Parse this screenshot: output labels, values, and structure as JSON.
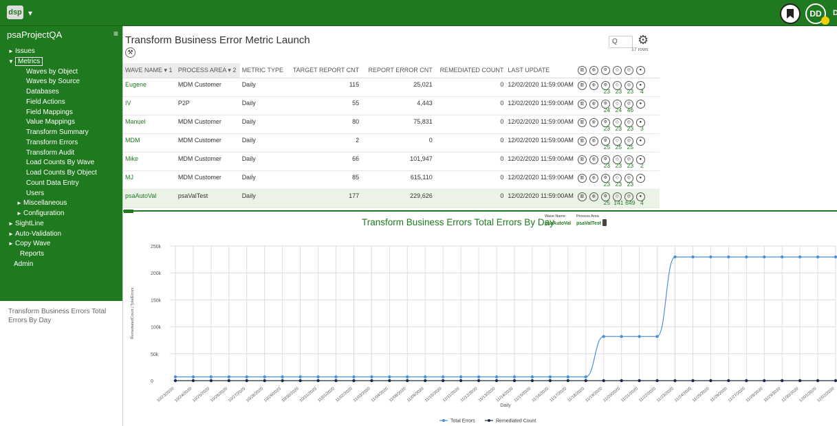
{
  "app": {
    "logo_text": "dsp",
    "logo_caret": "▾",
    "avatar_initials": "DD",
    "avatar_cut": "D",
    "colors": {
      "brand": "#1f7a1f",
      "accent_yellow": "#f0d000",
      "line_blue": "#4a90d9"
    }
  },
  "sidebar": {
    "project": "psaProjectQA",
    "menu_icon": "≡",
    "items": [
      {
        "label": "Issues",
        "level": 0,
        "arrow": "►"
      },
      {
        "label": "Metrics",
        "level": 0,
        "arrow": "▼",
        "active": true
      },
      {
        "label": "Waves by Object",
        "level": 1
      },
      {
        "label": "Waves by Source",
        "level": 1
      },
      {
        "label": "Databases",
        "level": 1
      },
      {
        "label": "Field Actions",
        "level": 1
      },
      {
        "label": "Field Mappings",
        "level": 1
      },
      {
        "label": "Value Mappings",
        "level": 1
      },
      {
        "label": "Transform Summary",
        "level": 1
      },
      {
        "label": "Transform Errors",
        "level": 1
      },
      {
        "label": "Transform Audit",
        "level": 1
      },
      {
        "label": "Load Counts By Wave",
        "level": 1
      },
      {
        "label": "Load Counts By Object",
        "level": 1
      },
      {
        "label": "Count Data Entry",
        "level": 1
      },
      {
        "label": "Users",
        "level": 1
      },
      {
        "label": "Miscellaneous",
        "level": 2,
        "arrow": "►"
      },
      {
        "label": "Configuration",
        "level": 2,
        "arrow": "►"
      },
      {
        "label": "SightLine",
        "level": 0,
        "arrow": "►"
      },
      {
        "label": "Auto-Validation",
        "level": 0,
        "arrow": "►"
      },
      {
        "label": "Copy Wave",
        "level": 0,
        "arrow": "►"
      },
      {
        "label": "Reports",
        "level": 3
      },
      {
        "label": "Admin",
        "level": 4
      }
    ],
    "footer": "Transform Business Errors Total Errors By Day"
  },
  "page": {
    "title": "Transform Business Error Metric Launch",
    "rows_count": "17 rows",
    "search_icon": "Q"
  },
  "table": {
    "headers": {
      "wave": "WAVE NAME ▾ 1",
      "area": "PROCESS AREA ▾ 2",
      "type": "METRIC TYPE",
      "target": "TARGET REPORT CNT",
      "error": "REPORT ERROR CNT",
      "remed": "REMEDIATED COUNT",
      "last": "LAST UPDATE"
    },
    "rows": [
      {
        "wave": "Eugene",
        "area": "MDM Customer",
        "type": "Daily",
        "target": "115",
        "error": "25,021",
        "remed": "0",
        "last": "12/02/2020 11:59:00AM",
        "counts": [
          "23",
          "23",
          "23",
          "4"
        ]
      },
      {
        "wave": "IV",
        "area": "P2P",
        "type": "Daily",
        "target": "55",
        "error": "4,443",
        "remed": "0",
        "last": "12/02/2020 11:59:00AM",
        "counts": [
          "24",
          "24",
          "46",
          ""
        ]
      },
      {
        "wave": "Manuel",
        "area": "MDM Customer",
        "type": "Daily",
        "target": "80",
        "error": "75,831",
        "remed": "0",
        "last": "12/02/2020 11:59:00AM",
        "counts": [
          "23",
          "23",
          "23",
          "3"
        ]
      },
      {
        "wave": "MDM",
        "area": "MDM Customer",
        "type": "Daily",
        "target": "2",
        "error": "0",
        "remed": "0",
        "last": "12/02/2020 11:59:00AM",
        "counts": [
          "25",
          "25",
          "25",
          ""
        ]
      },
      {
        "wave": "Mike",
        "area": "MDM Customer",
        "type": "Daily",
        "target": "66",
        "error": "101,947",
        "remed": "0",
        "last": "12/02/2020 11:59:00AM",
        "counts": [
          "23",
          "23",
          "23",
          "2"
        ]
      },
      {
        "wave": "MJ",
        "area": "MDM Customer",
        "type": "Daily",
        "target": "85",
        "error": "615,110",
        "remed": "0",
        "last": "12/02/2020 11:59:00AM",
        "counts": [
          "23",
          "23",
          "23",
          ""
        ]
      },
      {
        "wave": "psaAutoVal",
        "area": "psaValTest",
        "type": "Daily",
        "target": "177",
        "error": "229,626",
        "remed": "0",
        "last": "12/02/2020 11:59:00AM",
        "counts": [
          "25",
          "141",
          "649",
          "4"
        ],
        "selected": true
      }
    ]
  },
  "chart_meta": {
    "wave_label": "Wave Name",
    "wave_value": "psaAutoVal",
    "area_label": "Process Area",
    "area_value": "psaValTest"
  },
  "chart_data": {
    "type": "line",
    "title": "Transform Business Errors Total Errors By Day",
    "xlabel": "Daily",
    "ylabel": "RemediatedCount | TotalErrors",
    "ylim": [
      0,
      250000
    ],
    "yticks": [
      "0",
      "50k",
      "100k",
      "150k",
      "200k",
      "250k"
    ],
    "grid": true,
    "legend_position": "bottom",
    "categories": [
      "10/23/2020",
      "10/24/2020",
      "10/25/2020",
      "10/26/2020",
      "10/27/2020",
      "10/28/2020",
      "10/29/2020",
      "10/30/2020",
      "10/31/2020",
      "11/01/2020",
      "11/02/2020",
      "11/03/2020",
      "11/04/2020",
      "11/08/2020",
      "11/09/2020",
      "11/10/2020",
      "11/11/2020",
      "11/12/2020",
      "11/13/2020",
      "11/14/2020",
      "11/15/2020",
      "11/16/2020",
      "11/17/2020",
      "11/18/2020",
      "11/19/2020",
      "11/20/2020",
      "11/21/2020",
      "11/22/2020",
      "11/23/2020",
      "11/24/2020",
      "11/25/2020",
      "11/26/2020",
      "11/27/2020",
      "11/28/2020",
      "11/29/2020",
      "11/30/2020",
      "12/01/2020",
      "12/02/2020"
    ],
    "series": [
      {
        "name": "Total Errors",
        "color": "#4a90d9",
        "values": [
          7000,
          7000,
          7000,
          7000,
          7000,
          7000,
          7000,
          7000,
          7000,
          7000,
          7000,
          7000,
          7000,
          7000,
          7000,
          7000,
          7000,
          7000,
          7000,
          7000,
          7000,
          7000,
          7000,
          7000,
          82000,
          82000,
          82000,
          82000,
          229626,
          229626,
          229626,
          229626,
          229626,
          229626,
          229626,
          229626,
          229626,
          229626
        ]
      },
      {
        "name": "Remediated Count",
        "color": "#1a2a4a",
        "values": [
          0,
          0,
          0,
          0,
          0,
          0,
          0,
          0,
          0,
          0,
          0,
          0,
          0,
          0,
          0,
          0,
          0,
          0,
          0,
          0,
          0,
          0,
          0,
          0,
          0,
          0,
          0,
          0,
          0,
          0,
          0,
          0,
          0,
          0,
          0,
          0,
          0,
          0
        ]
      }
    ]
  }
}
